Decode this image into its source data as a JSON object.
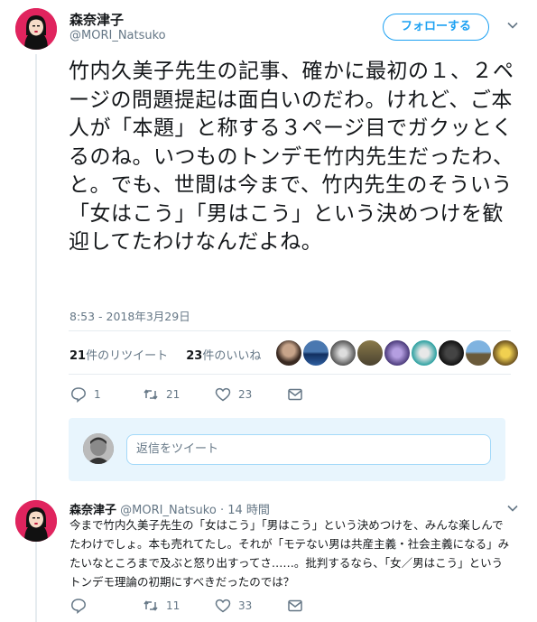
{
  "tweet": {
    "display_name": "森奈津子",
    "handle": "@MORI_Natsuko",
    "follow_label": "フォローする",
    "text": "竹内久美子先生の記事、確かに最初の１、２ページの問題提起は面白いのだわ。けれど、ご本人が「本題」と称する３ページ目でガクッとくるのね。いつものトンデモ竹内先生だったわ、と。でも、世間は今まで、竹内先生のそういう「女はこう」「男はこう」という決めつけを歓迎してたわけなんだよね。",
    "timestamp": "8:53 - 2018年3月29日",
    "retweet_count": "21",
    "retweet_label": "件のリツイート",
    "like_count": "23",
    "like_label": "件のいいね",
    "likers_count": 9,
    "actions": {
      "reply_count": "1",
      "retweet_count": "21",
      "like_count": "23"
    },
    "reply_placeholder": "返信をツイート"
  },
  "reply": {
    "display_name": "森奈津子",
    "handle": "@MORI_Natsuko",
    "time": "· 14 時間",
    "text": "今まで竹内久美子先生の「女はこう」「男はこう」という決めつけを、みんな楽しんでたわけでしょ。本も売れてたし。それが「モテない男は共産主義・社会主義になる」みたいなところまで及ぶと怒り出すってさ……。批判するなら、「女／男はこう」というトンデモ理論の初期にすべきだったのでは？",
    "actions": {
      "reply_count": "",
      "retweet_count": "11",
      "like_count": "33"
    }
  },
  "colors": {
    "accent": "#1da1f2",
    "avatar_bg": "#e0245e",
    "muted": "#657786"
  },
  "icons": [
    "reply-icon",
    "retweet-icon",
    "like-icon",
    "dm-icon",
    "caret-down-icon"
  ]
}
